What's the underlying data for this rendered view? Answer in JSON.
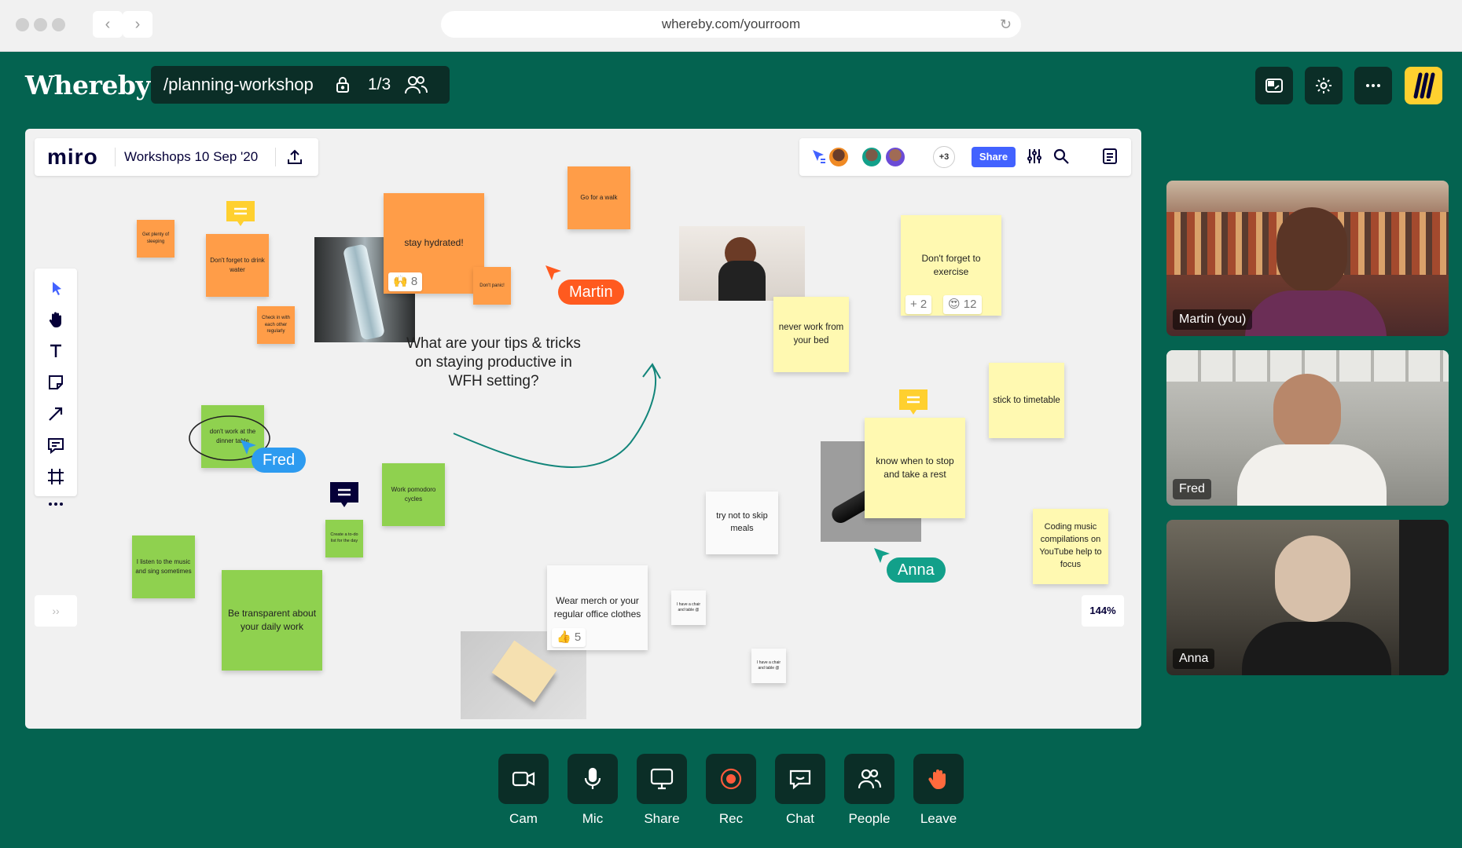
{
  "browser": {
    "url": "whereby.com/yourroom"
  },
  "header": {
    "brand": "Whereby",
    "room_name": "/planning-workshop",
    "participant_count": "1/3"
  },
  "miro": {
    "logo": "miro",
    "board_name": "Workshops 10 Sep '20",
    "more_collaborators": "+3",
    "share_label": "Share",
    "zoom": "144%"
  },
  "board": {
    "question": "What are your tips & tricks on staying productive in WFH setting?",
    "notes": {
      "sleep": "Get plenty of sleeping",
      "water": "Don't forget to drink water",
      "checkin": "Check in with each other regularly",
      "hydrated": "stay hydrated!",
      "dont_panic": "Don't panic!",
      "walk": "Go for a walk",
      "dinner_table": "don't work at the dinner table",
      "todo": "Create a to-do list for the day",
      "pomodoro": "Work pomodoro cycles",
      "music_sing": "I listen to the music and sing sometimes",
      "transparent": "Be transparent about your daily work",
      "merch": "Wear merch or your regular office clothes",
      "chair1": "I have a chair and table @",
      "chair2": "I have a chair and table @",
      "meals": "try not to skip meals",
      "bed": "never work from your bed",
      "exercise": "Don't forget to exercise",
      "stop_rest": "know when to stop and take a rest",
      "timetable": "stick to timetable",
      "coding_music": "Coding music compilations on YouTube help to focus"
    },
    "reactions": {
      "hydrated": "🙌 8",
      "merch": "👍 5",
      "exercise_plus": "+ 2",
      "exercise_heart": "😍 12"
    },
    "cursors": [
      {
        "name": "Martin",
        "color": "#ff5a1f"
      },
      {
        "name": "Fred",
        "color": "#2d9bf0"
      },
      {
        "name": "Anna",
        "color": "#12a08a"
      }
    ]
  },
  "participants": [
    {
      "name": "Martin (you)"
    },
    {
      "name": "Fred"
    },
    {
      "name": "Anna"
    }
  ],
  "controls": [
    {
      "label": "Cam",
      "icon": "camera-icon"
    },
    {
      "label": "Mic",
      "icon": "microphone-icon"
    },
    {
      "label": "Share",
      "icon": "screen-share-icon"
    },
    {
      "label": "Rec",
      "icon": "record-icon"
    },
    {
      "label": "Chat",
      "icon": "chat-icon"
    },
    {
      "label": "People",
      "icon": "people-icon"
    },
    {
      "label": "Leave",
      "icon": "wave-hand-icon"
    }
  ],
  "colors": {
    "app_bg": "#046350",
    "dark_button": "#0b2e27",
    "miro_share": "#4262ff",
    "sticky_orange": "#ff9d48",
    "sticky_yellow": "#fff9b1",
    "sticky_green": "#8fd14f"
  }
}
